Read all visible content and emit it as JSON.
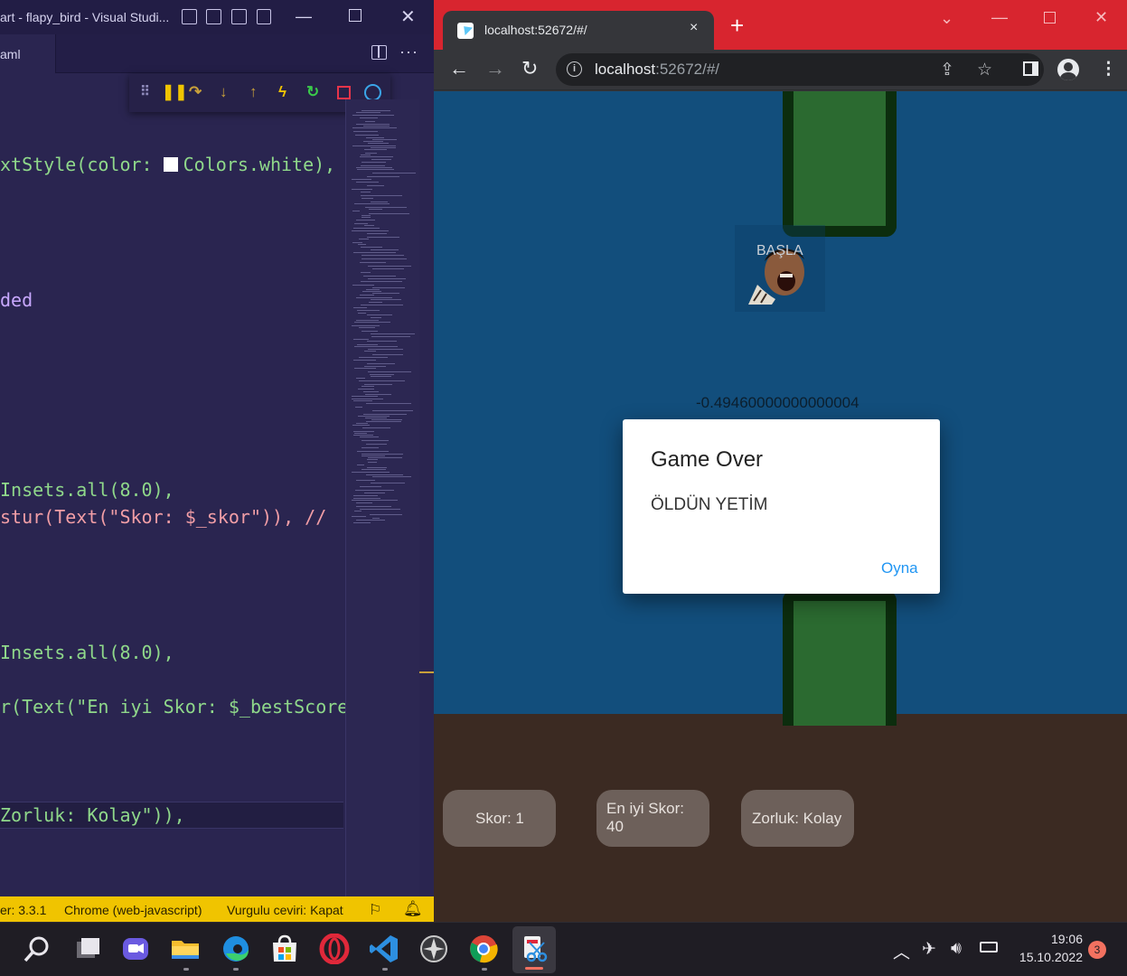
{
  "vscode": {
    "title": "art - flapy_bird - Visual Studi...",
    "tab_label": "aml",
    "more": "···",
    "code": [
      {
        "text": "xtStyle(color: ",
        "tail": "Colors.white),"
      },
      {
        "text": "ded"
      },
      {
        "text": "Insets.all(8.0),"
      },
      {
        "text": "stur(Text(\"Skor: $_skor\")), //"
      },
      {
        "text": "Insets.all(8.0),"
      },
      {
        "text": "r(Text(\"En iyi Skor: $_bestScore"
      },
      {
        "text": "Zorluk: Kolay\")),"
      }
    ],
    "status": {
      "version": "er: 3.3.1",
      "device": "Chrome (web-javascript)",
      "highlight": "Vurgulu ceviri: Kapat"
    },
    "colors": {
      "background": "#2a2550",
      "statusbar": "#f0c400"
    }
  },
  "chrome": {
    "tab_title": "localhost:52672/#/",
    "url_host": "localhost",
    "url_rest": ":52672/#/",
    "tab_close": "×",
    "new_tab": "+"
  },
  "game": {
    "start_label": "BAŞLA",
    "value_text": "-0.49460000000000004",
    "dialog": {
      "title": "Game Over",
      "body": "ÖLDÜN YETİM",
      "action": "Oyna"
    },
    "pills": {
      "score": "Skor: 1",
      "best_line1": "En iyi Skor:",
      "best_line2": "40",
      "difficulty": "Zorluk: Kolay"
    },
    "colors": {
      "sky": "#124e7c",
      "ground": "#3b2a22",
      "pipe": "#2b6a30",
      "pipe_border": "#0c2d0e",
      "pill": "#6d605a"
    }
  },
  "taskbar": {
    "time": "19:06",
    "date": "15.10.2022",
    "notifications": "3",
    "icons": [
      "search-icon",
      "task-view-icon",
      "chat-icon",
      "file-explorer-icon",
      "edge-icon",
      "store-icon",
      "opera-icon",
      "vscode-icon",
      "app-icon",
      "chrome-icon",
      "snipping-tool-icon"
    ]
  }
}
